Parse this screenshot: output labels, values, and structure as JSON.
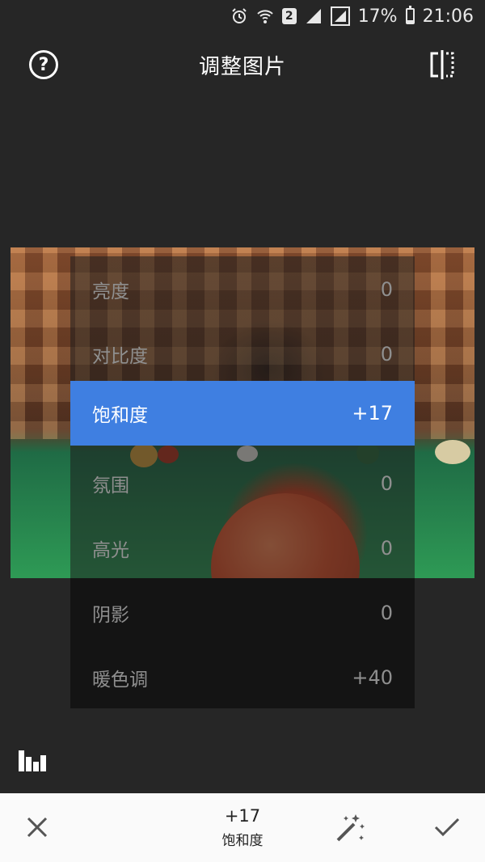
{
  "status_bar": {
    "sim_badge": "2",
    "battery_percent": "17%",
    "battery_level": 0.17,
    "time": "21:06"
  },
  "header": {
    "title": "调整图片",
    "help_icon": "question-circle-icon",
    "compare_icon": "compare-split-icon"
  },
  "adjustments": [
    {
      "label": "亮度",
      "value": "0",
      "active": false
    },
    {
      "label": "对比度",
      "value": "0",
      "active": false
    },
    {
      "label": "饱和度",
      "value": "+17",
      "active": true
    },
    {
      "label": "氛围",
      "value": "0",
      "active": false
    },
    {
      "label": "高光",
      "value": "0",
      "active": false
    },
    {
      "label": "阴影",
      "value": "0",
      "active": false
    },
    {
      "label": "暖色调",
      "value": "+40",
      "active": false
    }
  ],
  "bottom_bar": {
    "current_value": "+17",
    "current_label": "饱和度",
    "cancel_icon": "close-icon",
    "auto_icon": "magic-wand-icon",
    "confirm_icon": "check-icon"
  },
  "colors": {
    "background": "#262626",
    "accent": "#3f7fe1",
    "bottom_bar": "#fafafa"
  }
}
